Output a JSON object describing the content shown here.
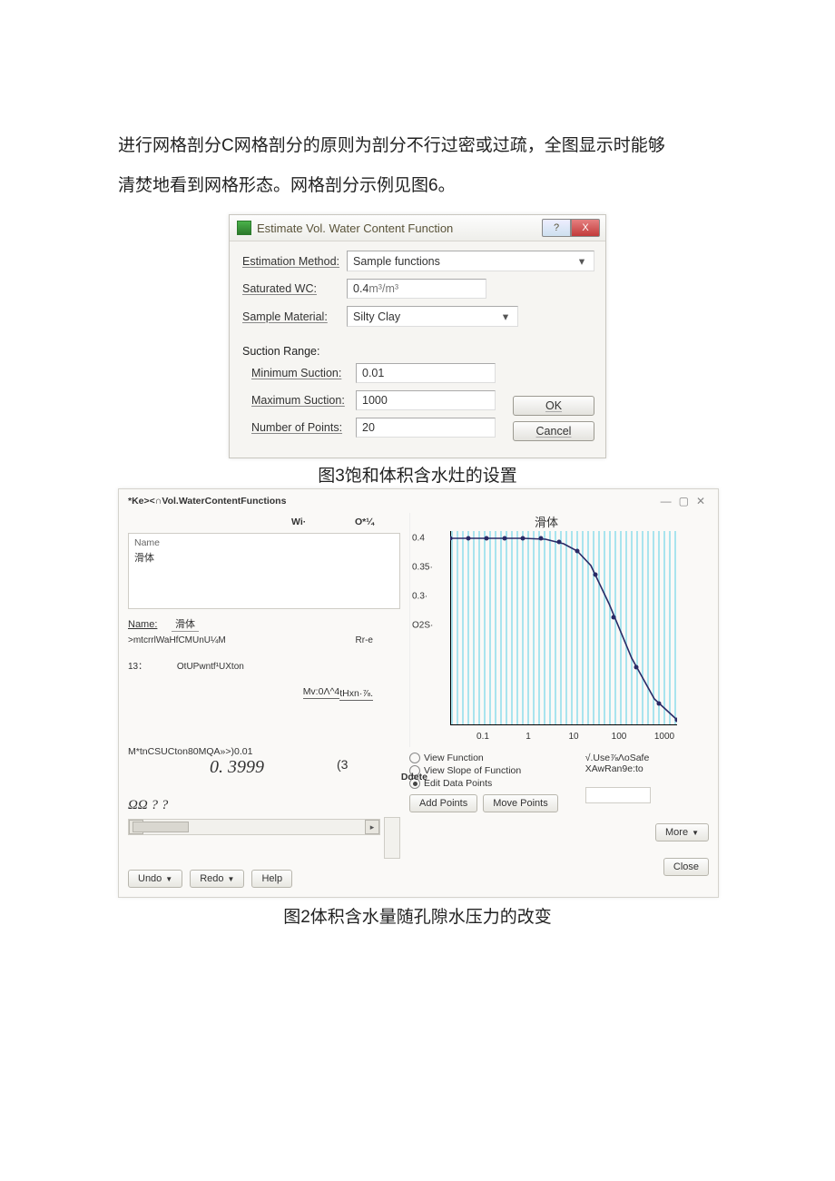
{
  "intro_line1": "进行网格剖分C网格剖分的原则为剖分不行过密或过疏，全图显示时能够",
  "intro_line2": "清焚地看到网格形态。网格剖分示例见图6。",
  "dlg1": {
    "title": "Estimate Vol. Water Content Function",
    "help": "?",
    "close": "X",
    "estimation_method_label": "Estimation Method:",
    "estimation_method_value": "Sample functions",
    "saturated_wc_label": "Saturated WC:",
    "saturated_wc_value": "0.4",
    "saturated_wc_unit": "m³/m³",
    "sample_material_label": "Sample Material:",
    "sample_material_value": "Silty Clay",
    "suction_range_label": "Suction Range:",
    "min_suction_label": "Minimum Suction:",
    "min_suction_value": "0.01",
    "max_suction_label": "Maximum Suction:",
    "max_suction_value": "1000",
    "num_points_label": "Number of Points:",
    "num_points_value": "20",
    "ok": "OK",
    "cancel": "Cancel"
  },
  "caption1": "图3饱和体积含水灶的设置",
  "dlg2": {
    "title": "*Ke><∩Vol.WaterContentFunctions",
    "win_min": "—",
    "win_max": "▢",
    "win_close": "✕",
    "col_w": "Wi·",
    "col_o": "O*¼",
    "list_header": "Name",
    "list_item": "滑体",
    "name_label": "Name:",
    "name_value": "滑体",
    "meta1": ">mtcrrlWaHfCMUnU¼M",
    "meta1_r": "Rr-e",
    "meta2_l": "13：",
    "meta2_r": "OtUPwntf¹UXton",
    "rhs1": "tHxn·⅞.",
    "rhs2": "Mv:0Λ^4",
    "val_left": "M*tnCSUCton80MQA»>)0.01",
    "val_big": "0. 3999",
    "three": "(3",
    "ddelete": "Ddete",
    "small_vals": "ΩΩ ? ?",
    "undo": "Undo",
    "redo": "Redo",
    "help": "Help",
    "chart_title": "滑体",
    "y_ticks": [
      "0.4",
      "0.35·",
      "0.3·",
      "O2S·"
    ],
    "x_ticks": [
      "0.1",
      "1",
      "10",
      "100",
      "1000"
    ],
    "radio1": "View Function",
    "radio2": "View Slope of Function",
    "radio3": "Edit Data Points",
    "chk1": "√.Use⅞ΛoSafe",
    "chk2": "XAwRan9e:to",
    "add_points": "Add Points",
    "move_points": "Move Points",
    "more": "More",
    "close": "Close"
  },
  "caption2": "图2体积含水量随孔隙水压力的改变",
  "chart_data": {
    "type": "line",
    "title": "滑体",
    "xlabel": "",
    "ylabel": "",
    "x_scale": "log",
    "xlim": [
      0.01,
      1000
    ],
    "ylim": [
      0.05,
      0.4
    ],
    "x": [
      0.01,
      0.03,
      0.1,
      0.3,
      1,
      2,
      3,
      5,
      10,
      30,
      100,
      300,
      1000
    ],
    "y": [
      0.4,
      0.4,
      0.4,
      0.4,
      0.4,
      0.395,
      0.385,
      0.37,
      0.33,
      0.24,
      0.16,
      0.1,
      0.055
    ]
  }
}
